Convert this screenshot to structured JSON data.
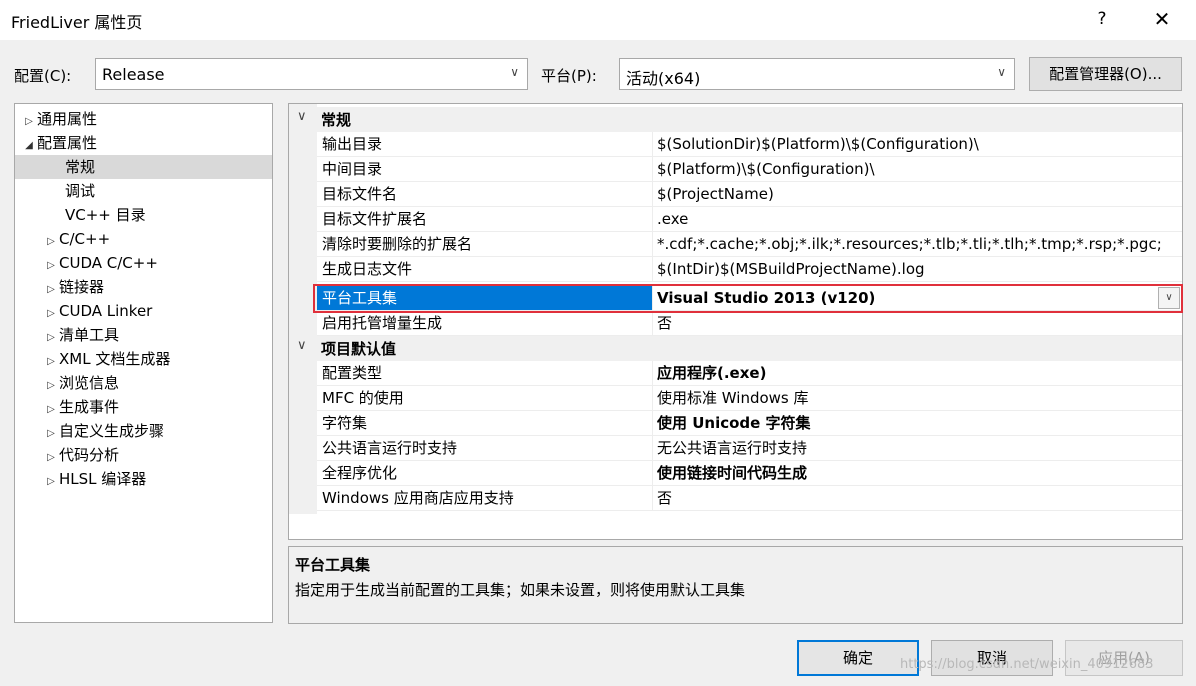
{
  "window": {
    "title": "FriedLiver 属性页",
    "help": "?",
    "close": "✕"
  },
  "toolbar": {
    "config_label": "配置(C):",
    "config_value": "Release",
    "platform_label": "平台(P):",
    "platform_value": "活动(x64)",
    "config_manager_button": "配置管理器(O)...",
    "dropdown_arrow": "∨"
  },
  "tree": {
    "items": [
      {
        "label": "通用属性",
        "expander": "▷"
      },
      {
        "label": "配置属性",
        "expander": "◢"
      },
      {
        "label": "常规",
        "expander": ""
      },
      {
        "label": "调试",
        "expander": ""
      },
      {
        "label": "VC++ 目录",
        "expander": ""
      },
      {
        "label": "C/C++",
        "expander": "▷"
      },
      {
        "label": "CUDA C/C++",
        "expander": "▷"
      },
      {
        "label": "链接器",
        "expander": "▷"
      },
      {
        "label": "CUDA Linker",
        "expander": "▷"
      },
      {
        "label": "清单工具",
        "expander": "▷"
      },
      {
        "label": "XML 文档生成器",
        "expander": "▷"
      },
      {
        "label": "浏览信息",
        "expander": "▷"
      },
      {
        "label": "生成事件",
        "expander": "▷"
      },
      {
        "label": "自定义生成步骤",
        "expander": "▷"
      },
      {
        "label": "代码分析",
        "expander": "▷"
      },
      {
        "label": "HLSL 编译器",
        "expander": "▷"
      }
    ]
  },
  "grid": {
    "chevron": "∨",
    "categories": [
      {
        "label": "常规",
        "rows": [
          {
            "name": "输出目录",
            "value": "$(SolutionDir)$(Platform)\\$(Configuration)\\"
          },
          {
            "name": "中间目录",
            "value": "$(Platform)\\$(Configuration)\\"
          },
          {
            "name": "目标文件名",
            "value": "$(ProjectName)"
          },
          {
            "name": "目标文件扩展名",
            "value": ".exe"
          },
          {
            "name": "清除时要删除的扩展名",
            "value": "*.cdf;*.cache;*.obj;*.ilk;*.resources;*.tlb;*.tli;*.tlh;*.tmp;*.rsp;*.pgc;"
          },
          {
            "name": "生成日志文件",
            "value": "$(IntDir)$(MSBuildProjectName).log"
          },
          {
            "name": "平台工具集",
            "value": "Visual Studio 2013 (v120)"
          },
          {
            "name": "启用托管增量生成",
            "value": "否"
          }
        ]
      },
      {
        "label": "项目默认值",
        "rows": [
          {
            "name": "配置类型",
            "value": "应用程序(.exe)"
          },
          {
            "name": "MFC 的使用",
            "value": "使用标准 Windows 库"
          },
          {
            "name": "字符集",
            "value": "使用 Unicode 字符集"
          },
          {
            "name": "公共语言运行时支持",
            "value": "无公共语言运行时支持"
          },
          {
            "name": "全程序优化",
            "value": "使用链接时间代码生成"
          },
          {
            "name": "Windows 应用商店应用支持",
            "value": "否"
          }
        ]
      }
    ]
  },
  "description": {
    "title": "平台工具集",
    "text": "指定用于生成当前配置的工具集；如果未设置，则将使用默认工具集"
  },
  "footer": {
    "ok": "确定",
    "cancel": "取消",
    "apply": "应用(A)",
    "watermark": "https://blog.csdn.net/weixin_40912683"
  }
}
